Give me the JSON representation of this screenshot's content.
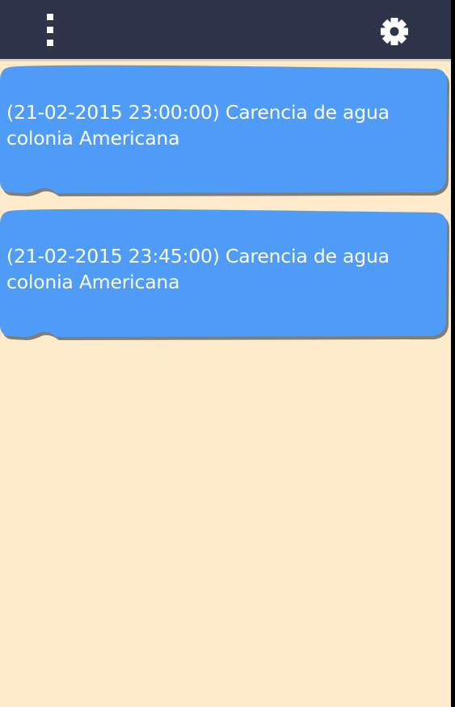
{
  "header": {
    "menu_icon": "overflow-menu-icon",
    "settings_icon": "gear-icon",
    "background": "#2E3449"
  },
  "alerts": {
    "bubble_color": "#4F9CF8",
    "background": "#FDEBCB",
    "items": [
      {
        "text": "(21-02-2015 23:00:00) Carencia de agua colonia Americana"
      },
      {
        "text": "(21-02-2015 23:45:00) Carencia de agua colonia Americana"
      }
    ]
  }
}
